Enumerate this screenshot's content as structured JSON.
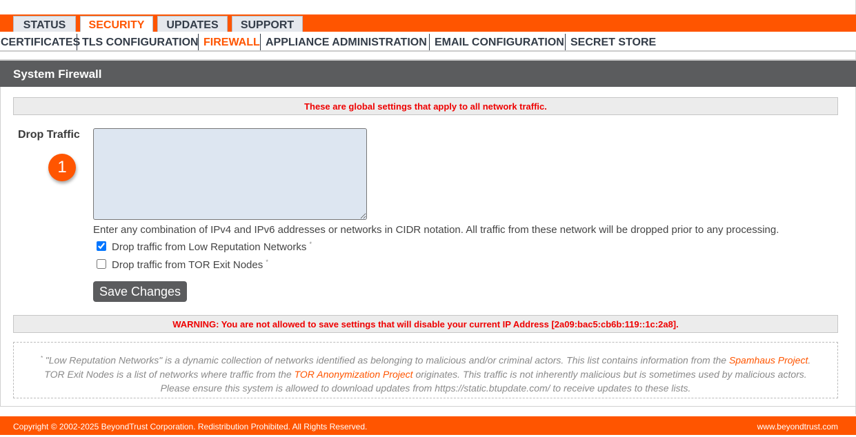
{
  "top_tabs": [
    "STATUS",
    "SECURITY",
    "UPDATES",
    "SUPPORT"
  ],
  "active_top_tab": "SECURITY",
  "sub_nav": [
    "CERTIFICATES",
    "TLS CONFIGURATION",
    "FIREWALL",
    "APPLIANCE ADMINISTRATION",
    "EMAIL CONFIGURATION",
    "SECRET STORE"
  ],
  "active_sub_nav": "FIREWALL",
  "panel": {
    "title": "System Firewall",
    "global_notice": "These are global settings that apply to all network traffic.",
    "drop_traffic_label": "Drop Traffic",
    "callout_number": "1",
    "drop_traffic_value": "",
    "help_text": "Enter any combination of IPv4 and IPv6 addresses or networks in CIDR notation. All traffic from these network will be dropped prior to any processing.",
    "checkboxes": [
      {
        "label": "Drop traffic from Low Reputation Networks",
        "marker": "*",
        "checked": true
      },
      {
        "label": "Drop traffic from TOR Exit Nodes",
        "marker": "*",
        "checked": false
      }
    ],
    "save_label": "Save Changes",
    "warning": "WARNING: You are not allowed to save settings that will disable your current IP Address [2a09:bac5:cb6b:119::1c:2a8].",
    "footnote": {
      "marker": "*",
      "line1_a": " \"Low Reputation Networks\" is a dynamic collection of networks identified as belonging to malicious and/or criminal actors. This list contains information from the ",
      "spamhaus_link": "Spamhaus Project",
      "line1_b": ".",
      "line2_a": "TOR Exit Nodes is a list of networks where traffic from the ",
      "tor_link": "TOR Anonymization Project",
      "line2_b": " originates. This traffic is not inherently malicious but is sometimes used by malicious actors.",
      "line3": "Please ensure this system is allowed to download updates from https://static.btupdate.com/ to receive updates to these lists."
    }
  },
  "footer": {
    "copyright": "Copyright © 2002-2025 BeyondTrust Corporation. Redistribution Prohibited. All Rights Reserved.",
    "website": "www.beyondtrust.com"
  },
  "colors": {
    "accent": "#ff5500",
    "header_bg": "#5b5c5e",
    "warning_text": "#ee0000",
    "textarea_bg": "#dde6f1"
  }
}
